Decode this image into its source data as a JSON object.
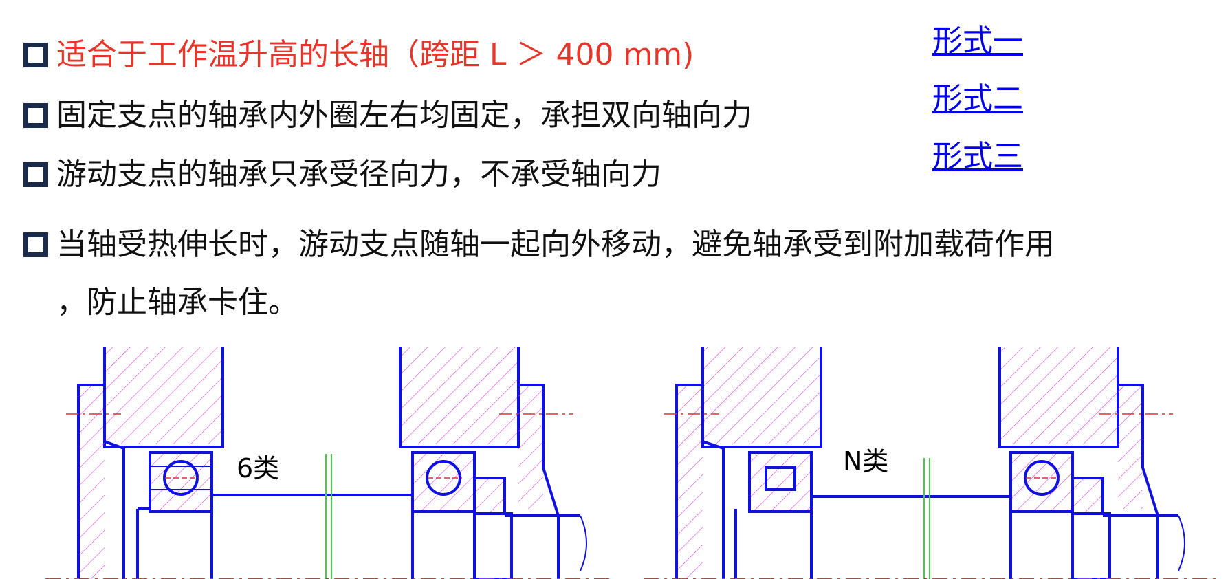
{
  "bullets": [
    {
      "text": "适合于工作温升高的长轴（跨距 L ＞ 400 mm)",
      "color": "#e8352a"
    },
    {
      "text": "固定支点的轴承内外圈左右均固定，承担双向轴向力",
      "color": "#111111"
    },
    {
      "text": "游动支点的轴承只承受径向力，不承受轴向力",
      "color": "#111111"
    },
    {
      "text": "当轴受热伸长时，游动支点随轴一起向外移动，避免轴承受到附加载荷作用",
      "color": "#111111"
    }
  ],
  "bullet_continuation": "，防止轴承卡住。",
  "links": [
    {
      "label": "形式一"
    },
    {
      "label": "形式二"
    },
    {
      "label": "形式三"
    }
  ],
  "drawings": {
    "left_label": "6类",
    "right_label": "N类",
    "outline_color": "#1010e0",
    "hatch_color": "#e040e0",
    "centerline_color": "#e03030",
    "gap_line_color": "#40d040"
  }
}
